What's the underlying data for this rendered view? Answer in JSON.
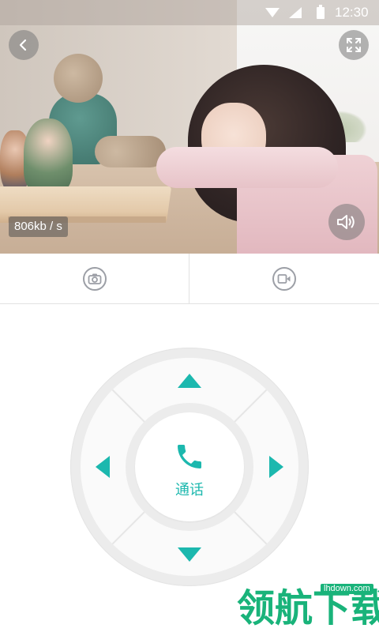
{
  "status_bar": {
    "time": "12:30",
    "icons": [
      "wifi-icon",
      "signal-icon",
      "battery-icon"
    ]
  },
  "video": {
    "bitrate": "806kb / s",
    "buttons": {
      "back": "back-arrow-icon",
      "fullscreen": "fullscreen-icon",
      "sound": "speaker-icon"
    }
  },
  "actions": [
    {
      "name": "snapshot",
      "icon": "camera-icon"
    },
    {
      "name": "record",
      "icon": "video-record-icon"
    }
  ],
  "dpad": {
    "center_label": "通话",
    "center_icon": "phone-icon",
    "directions": [
      "up",
      "down",
      "left",
      "right"
    ]
  },
  "watermark": {
    "text": "领航下载",
    "url": "lhdown.com"
  },
  "colors": {
    "accent": "#1cb8ae",
    "icon_gray": "#9c9fa6",
    "watermark": "#19b37a"
  }
}
